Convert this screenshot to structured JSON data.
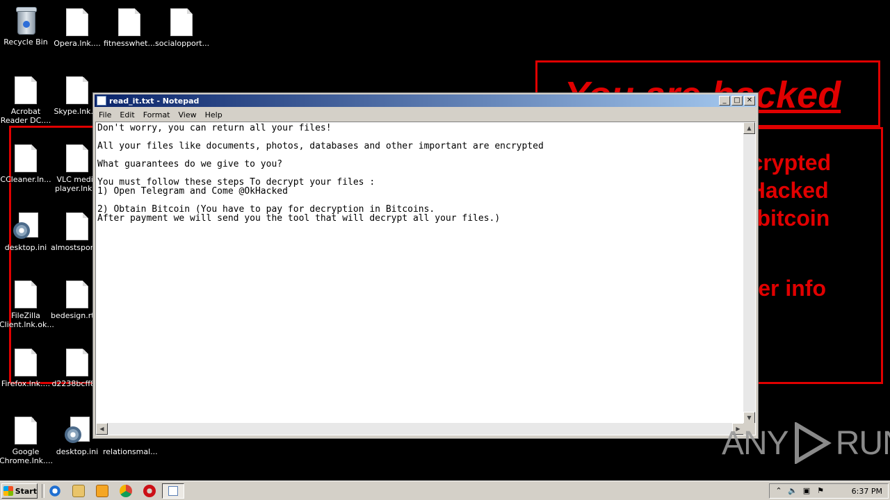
{
  "desktop": {
    "icons": [
      {
        "label": "Recycle Bin"
      },
      {
        "label": "Opera.lnk...."
      },
      {
        "label": "fitnesswhet..."
      },
      {
        "label": "socialopport..."
      },
      {
        "label": "Acrobat Reader DC...."
      },
      {
        "label": "Skype.lnk...."
      },
      {
        "label": "CCleaner.ln..."
      },
      {
        "label": "VLC media player.lnk..."
      },
      {
        "label": "desktop.ini"
      },
      {
        "label": "almostsport..."
      },
      {
        "label": "FileZilla Client.lnk.ok..."
      },
      {
        "label": "bedesign.rtf..."
      },
      {
        "label": "Firefox.lnk...."
      },
      {
        "label": "d2238bcff8..."
      },
      {
        "label": "Google Chrome.lnk...."
      },
      {
        "label": "desktop.ini"
      },
      {
        "label": "relationsmal..."
      }
    ]
  },
  "wallpaper": {
    "heading": "You are hacked",
    "lines": [
      "ncrypted",
      "kHacked",
      "n bitcoin",
      "pter info"
    ],
    "accent_color": "#e00000"
  },
  "notepad": {
    "title": "read_it.txt - Notepad",
    "menu": [
      "File",
      "Edit",
      "Format",
      "View",
      "Help"
    ],
    "content": "Don't worry, you can return all your files!\n\nAll your files like documents, photos, databases and other important are encrypted\n\nWhat guarantees do we give to you?\n\nYou must follow these steps To decrypt your files :\n1) Open Telegram and Come @OkHacked\n\n2) Obtain Bitcoin (You have to pay for decryption in Bitcoins.\nAfter payment we will send you the tool that will decrypt all your files.)"
  },
  "watermark": {
    "left": "ANY",
    "right": "RUN"
  },
  "taskbar": {
    "start_label": "Start",
    "quick_launch": [
      "ie-icon",
      "explorer-icon",
      "media-player-icon",
      "chrome-icon",
      "opera-icon"
    ],
    "tray_icons": [
      "chevron-up-icon",
      "volume-icon",
      "network-icon",
      "flag-icon"
    ],
    "clock": "6:37 PM"
  }
}
